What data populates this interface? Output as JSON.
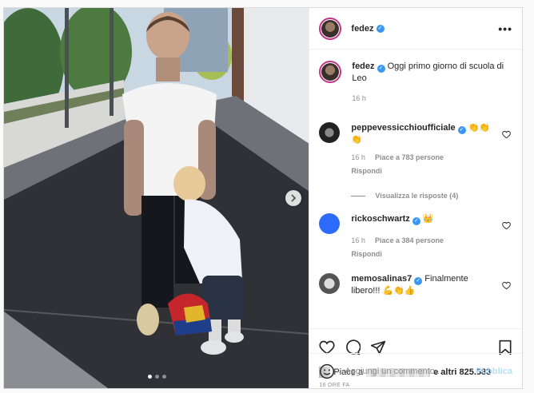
{
  "post": {
    "username": "fedez",
    "more_label": "•••",
    "caption": {
      "username": "fedez",
      "text": "Oggi primo giorno di scuola di Leo",
      "time": "16 h"
    },
    "comments": [
      {
        "username": "peppevessicchioufficiale",
        "text": "👏👏👏",
        "time": "16 h",
        "likes": "Piace a 783 persone",
        "reply": "Rispondi",
        "avatar_color": "#444444"
      },
      {
        "username": "rickoschwartz",
        "text": "👑",
        "time": "16 h",
        "likes": "Piace a 384 persone",
        "reply": "Rispondi",
        "avatar_color": "#2d6bff"
      },
      {
        "username": "memosalinas7",
        "text": "Finalmente libero!!! 💪👏👍",
        "avatar_color": "#7a7a7a"
      }
    ],
    "view_replies": "Visualizza le risposte (4)",
    "likes_prefix": "Piace a",
    "likes_suffix": "e altri 825.583",
    "timestamp": "16 ORE FA",
    "comment_placeholder": "Aggiungi un commento...",
    "publish_label": "Pubblica"
  },
  "icons": {
    "heart": "heart-icon",
    "comment": "comment-icon",
    "share": "share-icon",
    "bookmark": "bookmark-icon",
    "emoji": "emoji-icon",
    "next": "chevron-right-icon"
  },
  "colors": {
    "verified": "#3897f0",
    "publish_disabled": "#b2dffc",
    "story_ring": "#c13584"
  }
}
